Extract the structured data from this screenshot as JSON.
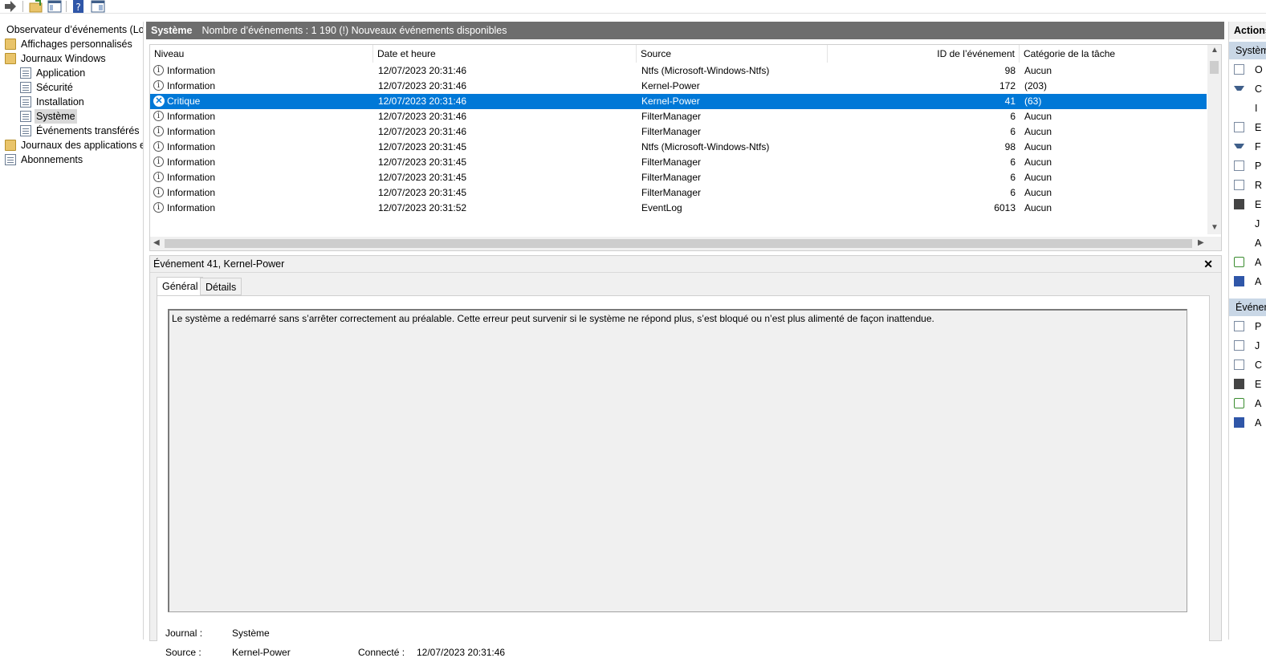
{
  "toolbar": {
    "buttons": [
      "forward-icon",
      "open-log-icon",
      "show-pane-icon",
      "help-icon",
      "action-pane-icon"
    ]
  },
  "tree": {
    "root": "Observateur d’événements (Local)",
    "items": [
      {
        "label": "Affichages personnalisés"
      },
      {
        "label": "Journaux Windows"
      },
      {
        "label": "Application"
      },
      {
        "label": "Sécurité"
      },
      {
        "label": "Installation"
      },
      {
        "label": "Système"
      },
      {
        "label": "Événements transférés"
      },
      {
        "label": "Journaux des applications et services"
      },
      {
        "label": "Abonnements"
      }
    ]
  },
  "header": {
    "title": "Système",
    "info": "Nombre d’événements : 1 190 (!) Nouveaux événements disponibles"
  },
  "columns": [
    "Niveau",
    "Date et heure",
    "Source",
    "ID de l’événement",
    "Catégorie de la tâche"
  ],
  "rows": [
    {
      "level": "Information",
      "date": "12/07/2023 20:31:46",
      "source": "Ntfs (Microsoft-Windows-Ntfs)",
      "id": "98",
      "cat": "Aucun"
    },
    {
      "level": "Information",
      "date": "12/07/2023 20:31:46",
      "source": "Kernel-Power",
      "id": "172",
      "cat": "(203)"
    },
    {
      "level": "Critique",
      "date": "12/07/2023 20:31:46",
      "source": "Kernel-Power",
      "id": "41",
      "cat": "(63)"
    },
    {
      "level": "Information",
      "date": "12/07/2023 20:31:46",
      "source": "FilterManager",
      "id": "6",
      "cat": "Aucun"
    },
    {
      "level": "Information",
      "date": "12/07/2023 20:31:46",
      "source": "FilterManager",
      "id": "6",
      "cat": "Aucun"
    },
    {
      "level": "Information",
      "date": "12/07/2023 20:31:45",
      "source": "Ntfs (Microsoft-Windows-Ntfs)",
      "id": "98",
      "cat": "Aucun"
    },
    {
      "level": "Information",
      "date": "12/07/2023 20:31:45",
      "source": "FilterManager",
      "id": "6",
      "cat": "Aucun"
    },
    {
      "level": "Information",
      "date": "12/07/2023 20:31:45",
      "source": "FilterManager",
      "id": "6",
      "cat": "Aucun"
    },
    {
      "level": "Information",
      "date": "12/07/2023 20:31:45",
      "source": "FilterManager",
      "id": "6",
      "cat": "Aucun"
    },
    {
      "level": "Information",
      "date": "12/07/2023 20:31:52",
      "source": "EventLog",
      "id": "6013",
      "cat": "Aucun"
    }
  ],
  "detail": {
    "title": "Événement 41, Kernel-Power",
    "tabs": [
      "Général",
      "Détails"
    ],
    "description": "Le système a redémarré sans s’arrêter correctement au préalable. Cette erreur peut survenir si le système ne répond plus, s’est bloqué ou n’est plus alimenté de façon inattendue.",
    "journal_label": "Journal :",
    "journal_value": "Système",
    "source_label": "Source :",
    "source_value": "Kernel-Power",
    "logged_label": "Connecté :",
    "logged_value": "12/07/2023 20:31:46"
  },
  "actions": {
    "title": "Actions",
    "section1": "Système",
    "items1": [
      "O",
      "C",
      "I",
      "E",
      "F",
      "P",
      "R",
      "E",
      "J",
      "A",
      "A",
      "A"
    ],
    "section2": "Événement",
    "items2": [
      "P",
      "J",
      "C",
      "E",
      "A",
      "A"
    ]
  }
}
